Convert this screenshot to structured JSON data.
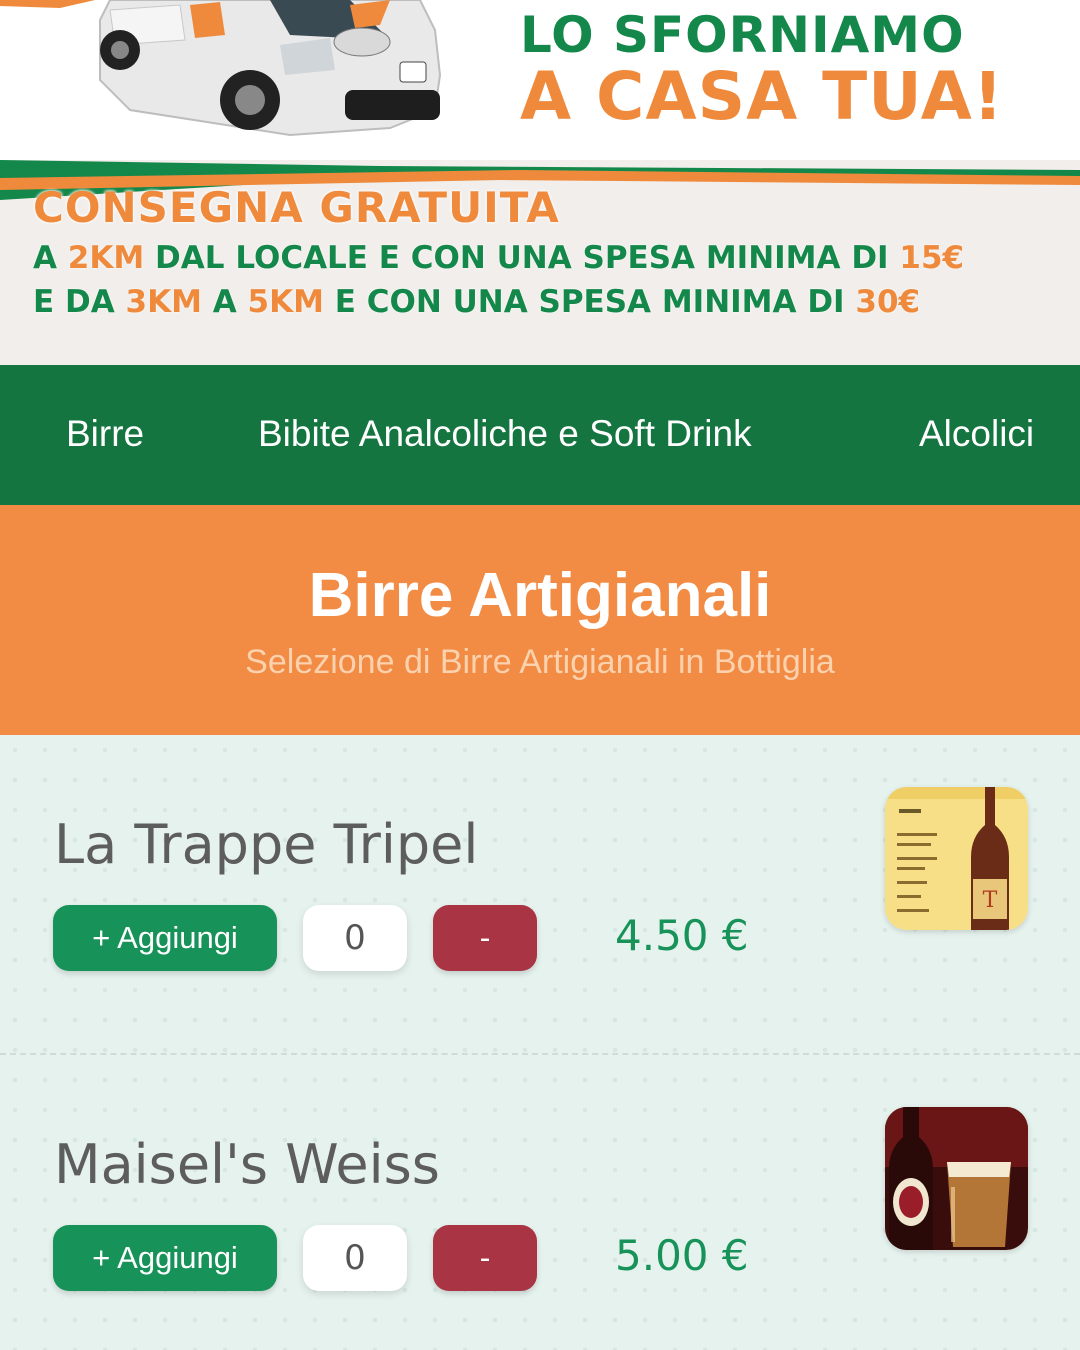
{
  "hero": {
    "title_line1": "LO SFORNIAMO",
    "title_line2": "A CASA TUA!",
    "delivery_head": "CONSEGNA GRATUITA",
    "delivery_line1": {
      "prefix": "A ",
      "km": "2KM",
      "middle": " DAL LOCALE E CON UNA SPESA MINIMA DI ",
      "amount": "15€"
    },
    "delivery_line2": {
      "prefix": "E DA ",
      "km_from": "3KM",
      "mid1": " A ",
      "km_to": "5KM",
      "middle": " E CON UNA SPESA MINIMA DI ",
      "amount": "30€"
    }
  },
  "nav": {
    "items": [
      {
        "label": "Birre"
      },
      {
        "label": "Bibite Analcoliche e Soft Drink"
      },
      {
        "label": "Alcolici"
      }
    ]
  },
  "section": {
    "title": "Birre Artigianali",
    "subtitle": "Selezione di Birre Artigianali in Bottiglia"
  },
  "products": [
    {
      "name": "La Trappe Tripel",
      "add_label": "+ Aggiungi",
      "quantity": "0",
      "minus_label": "-",
      "price": "4.50 €",
      "image_icon": "beer-bottle-label-image"
    },
    {
      "name": "Maisel's Weiss",
      "add_label": "+ Aggiungi",
      "quantity": "0",
      "minus_label": "-",
      "price": "5.00 €",
      "image_icon": "beer-glass-image"
    }
  ],
  "colors": {
    "green": "#157540",
    "button_green": "#17935a",
    "orange": "#f28b43",
    "minus_red": "#a93443"
  }
}
